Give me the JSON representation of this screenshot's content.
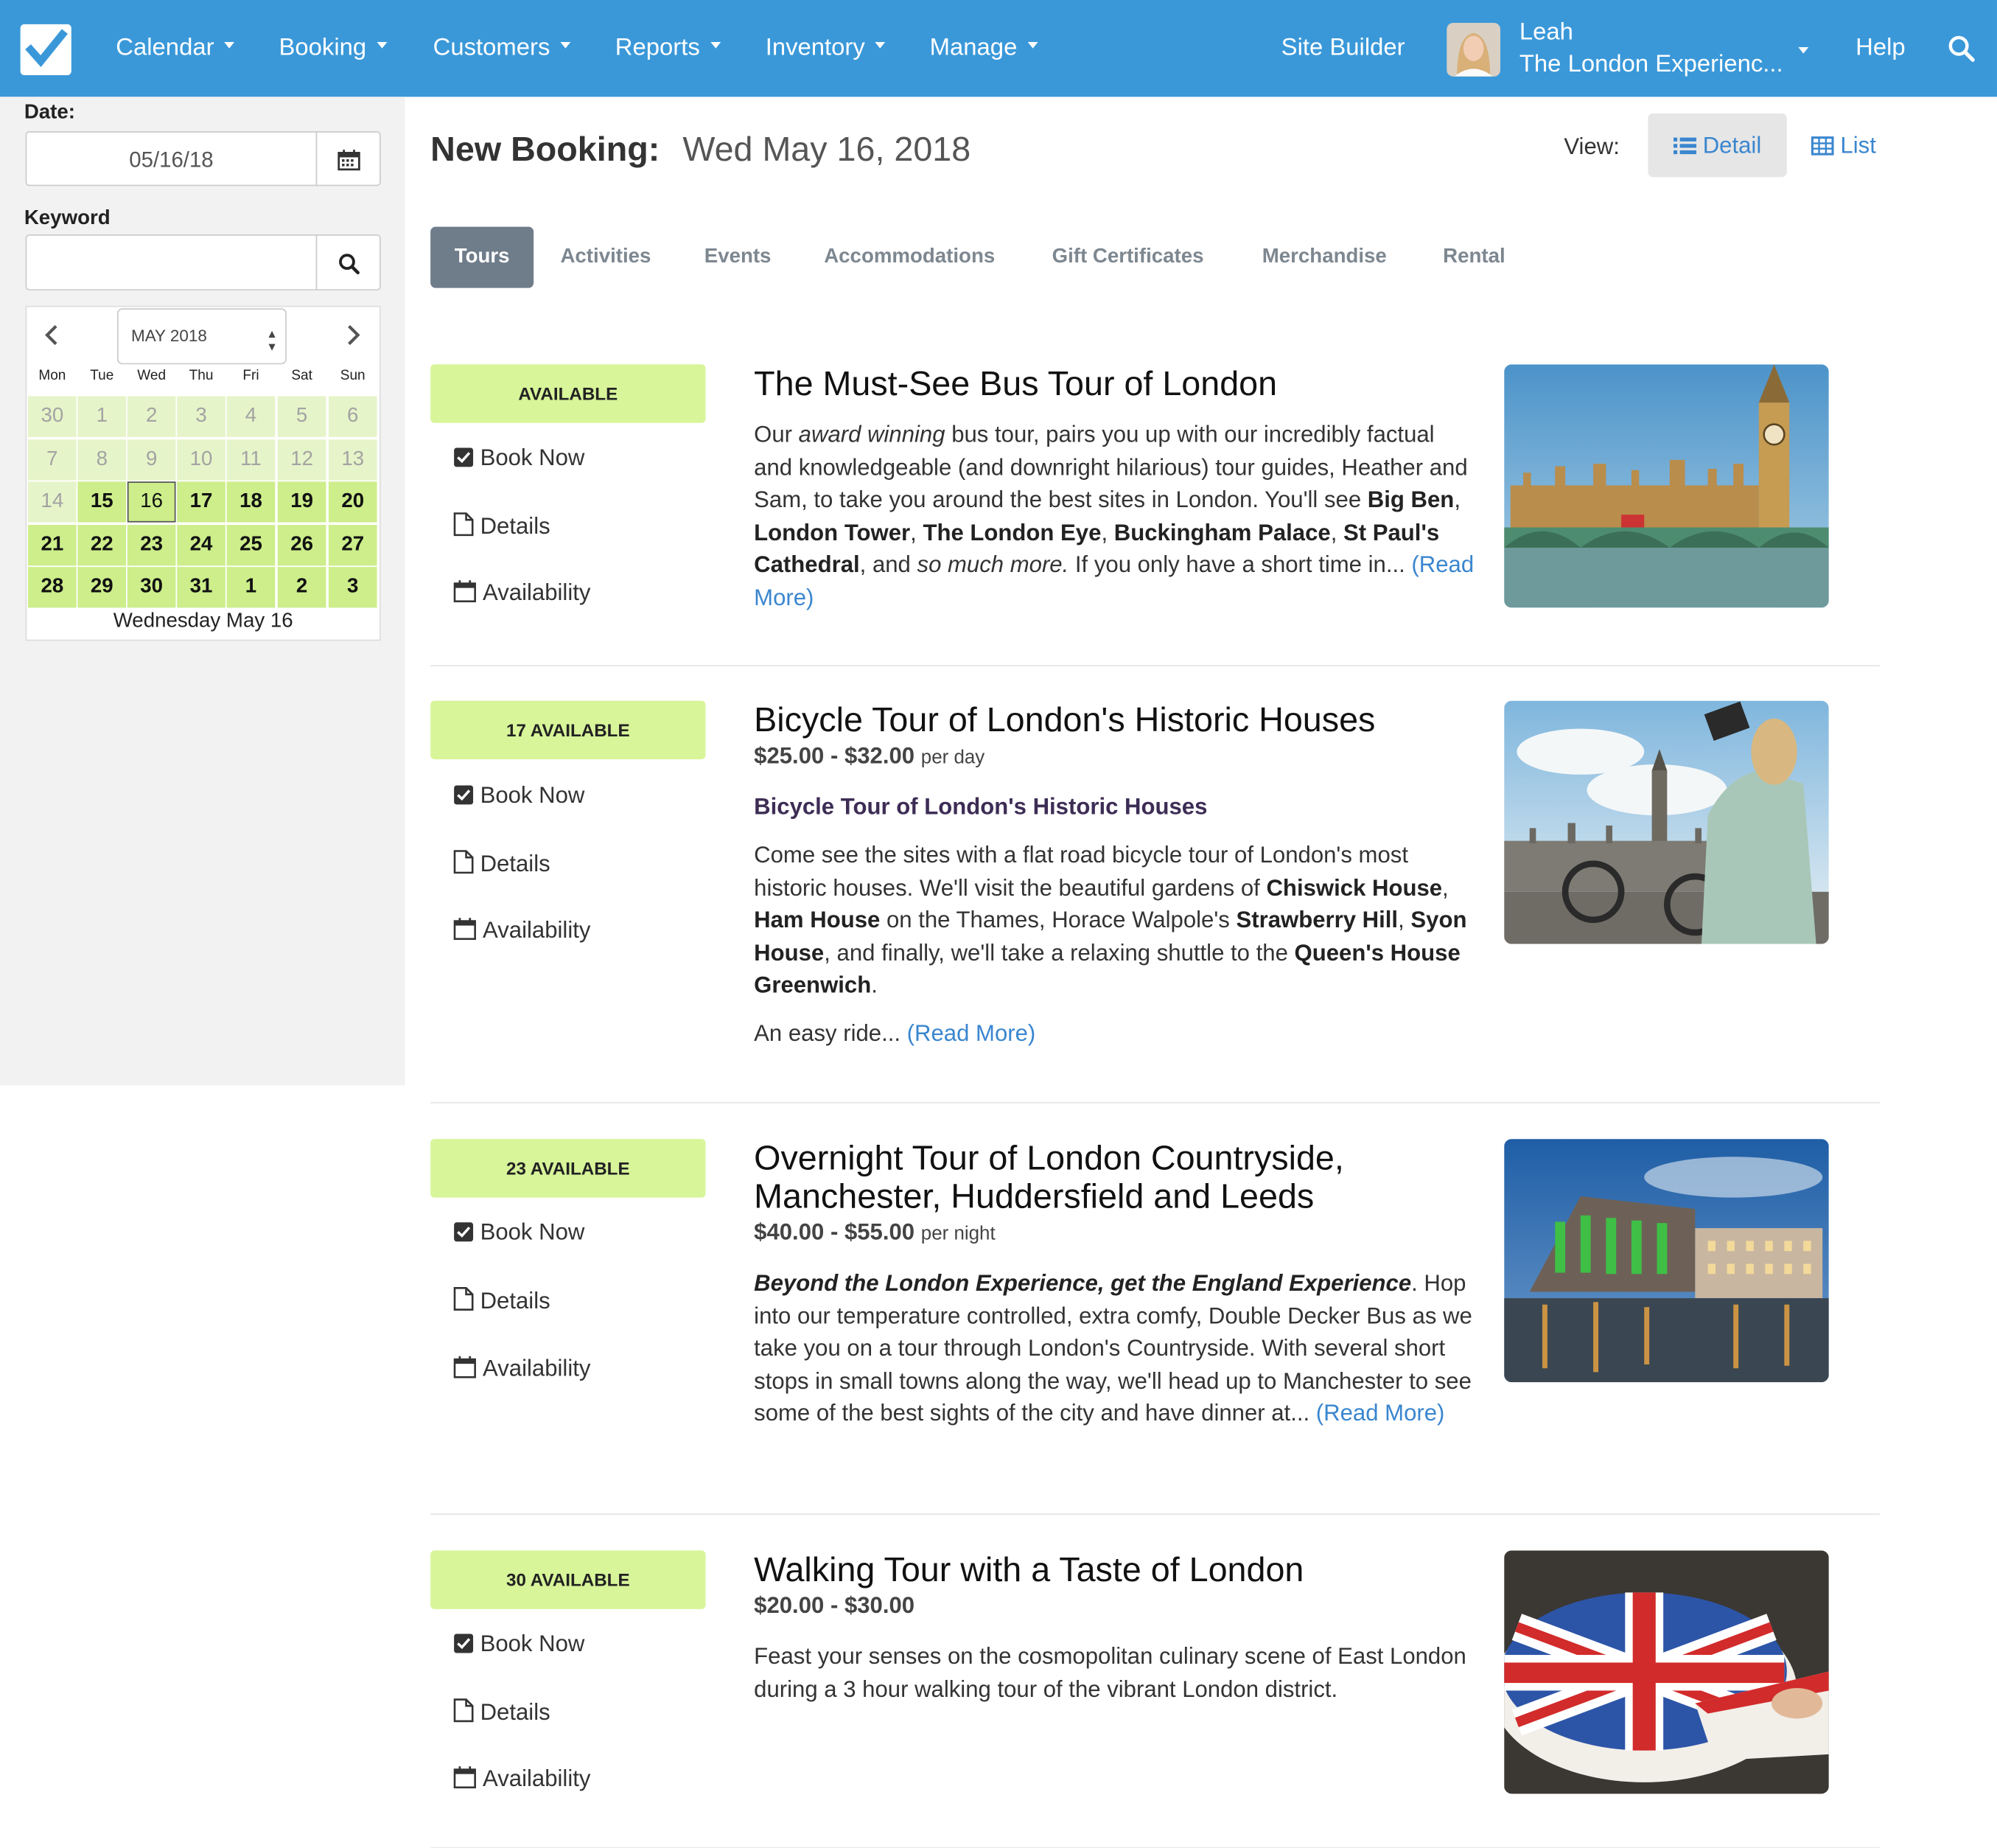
{
  "nav": {
    "menu": [
      {
        "label": "Calendar"
      },
      {
        "label": "Booking"
      },
      {
        "label": "Customers"
      },
      {
        "label": "Reports"
      },
      {
        "label": "Inventory"
      },
      {
        "label": "Manage"
      }
    ],
    "site_builder": "Site Builder",
    "user_name": "Leah",
    "user_org": "The London Experienc...",
    "help": "Help"
  },
  "sidebar": {
    "date_label": "Date:",
    "date_value": "05/16/18",
    "keyword_label": "Keyword",
    "keyword_value": "",
    "calendar": {
      "month": "MAY 2018",
      "dow": [
        "Mon",
        "Tue",
        "Wed",
        "Thu",
        "Fri",
        "Sat",
        "Sun"
      ],
      "days": [
        "30",
        "1",
        "2",
        "3",
        "4",
        "5",
        "6",
        "7",
        "8",
        "9",
        "10",
        "11",
        "12",
        "13",
        "14",
        "15",
        "16",
        "17",
        "18",
        "19",
        "20",
        "21",
        "22",
        "23",
        "24",
        "25",
        "26",
        "27",
        "28",
        "29",
        "30",
        "31",
        "1",
        "2",
        "3"
      ],
      "selected_day": "16",
      "first_available_index": 15,
      "footer": "Wednesday May 16"
    }
  },
  "header": {
    "title": "New Booking:",
    "date": "Wed May 16, 2018",
    "view_label": "View:",
    "view_detail": "Detail",
    "view_list": "List"
  },
  "tabs": [
    "Tours",
    "Activities",
    "Events",
    "Accommodations",
    "Gift Certificates",
    "Merchandise",
    "Rental"
  ],
  "actions": {
    "book": "Book Now",
    "details": "Details",
    "availability": "Availability"
  },
  "read_more": "(Read More)",
  "listings": [
    {
      "badge": "AVAILABLE",
      "title": "The Must-See Bus Tour of London",
      "desc": [
        {
          "t": "Our "
        },
        {
          "t": "award winning",
          "s": "i"
        },
        {
          "t": " bus tour, pairs you up with our incredibly factual and knowledgeable (and downright hilarious) tour guides, Heather and Sam, to take you around the best sites in London. You'll see "
        },
        {
          "t": "Big Ben",
          "s": "b"
        },
        {
          "t": ", "
        },
        {
          "t": "London Tower",
          "s": "b"
        },
        {
          "t": ", "
        },
        {
          "t": "The London Eye",
          "s": "b"
        },
        {
          "t": ", "
        },
        {
          "t": "Buckingham Palace",
          "s": "b"
        },
        {
          "t": ", "
        },
        {
          "t": "St Paul's Cathedral",
          "s": "b"
        },
        {
          "t": ", and "
        },
        {
          "t": "so much more.",
          "s": "i"
        },
        {
          "t": " If you only have a short time in... "
        }
      ],
      "image": "big-ben-parliament-photo"
    },
    {
      "badge": "17 AVAILABLE",
      "title": "Bicycle Tour of London's Historic Houses",
      "price": "$25.00 - $32.00",
      "unit": "per day",
      "subtitle": "Bicycle Tour of London's Historic Houses",
      "desc": [
        {
          "t": "Come see the sites with a flat road bicycle tour of London's most historic houses. We'll visit the beautiful gardens of "
        },
        {
          "t": "Chiswick House",
          "s": "b"
        },
        {
          "t": ", "
        },
        {
          "t": "Ham House",
          "s": "b"
        },
        {
          "t": " on the Thames, Horace Walpole's "
        },
        {
          "t": "Strawberry Hill",
          "s": "b"
        },
        {
          "t": ", "
        },
        {
          "t": "Syon House",
          "s": "b"
        },
        {
          "t": ", and finally, we'll take a relaxing shuttle to the "
        },
        {
          "t": "Queen's House Greenwich",
          "s": "b"
        },
        {
          "t": "."
        }
      ],
      "desc2": "An easy ride... ",
      "image": "cyclist-photographing-big-ben-photo"
    },
    {
      "badge": "23 AVAILABLE",
      "title": "Overnight Tour of London Countryside, Manchester, Huddersfield and Leeds",
      "price": "$40.00 - $55.00",
      "unit": "per night",
      "desc": [
        {
          "t": "Beyond the London Experience, get the England Experience",
          "s": "bi"
        },
        {
          "t": ". Hop into our temperature controlled, extra comfy, Double Decker Bus as we take you on a tour through London's Countryside. With several short stops in small towns along the way, we'll head up to Manchester to see some of the best sights of the city and have dinner at... "
        }
      ],
      "image": "manchester-square-night-photo"
    },
    {
      "badge": "30 AVAILABLE",
      "title": "Walking Tour with a Taste of London",
      "price": "$20.00 - $30.00",
      "unit": "",
      "desc": [
        {
          "t": "Feast your senses on the cosmopolitan culinary scene of East London during a 3 hour walking tour of the vibrant London district."
        }
      ],
      "image": "union-jack-cake-photo"
    }
  ]
}
